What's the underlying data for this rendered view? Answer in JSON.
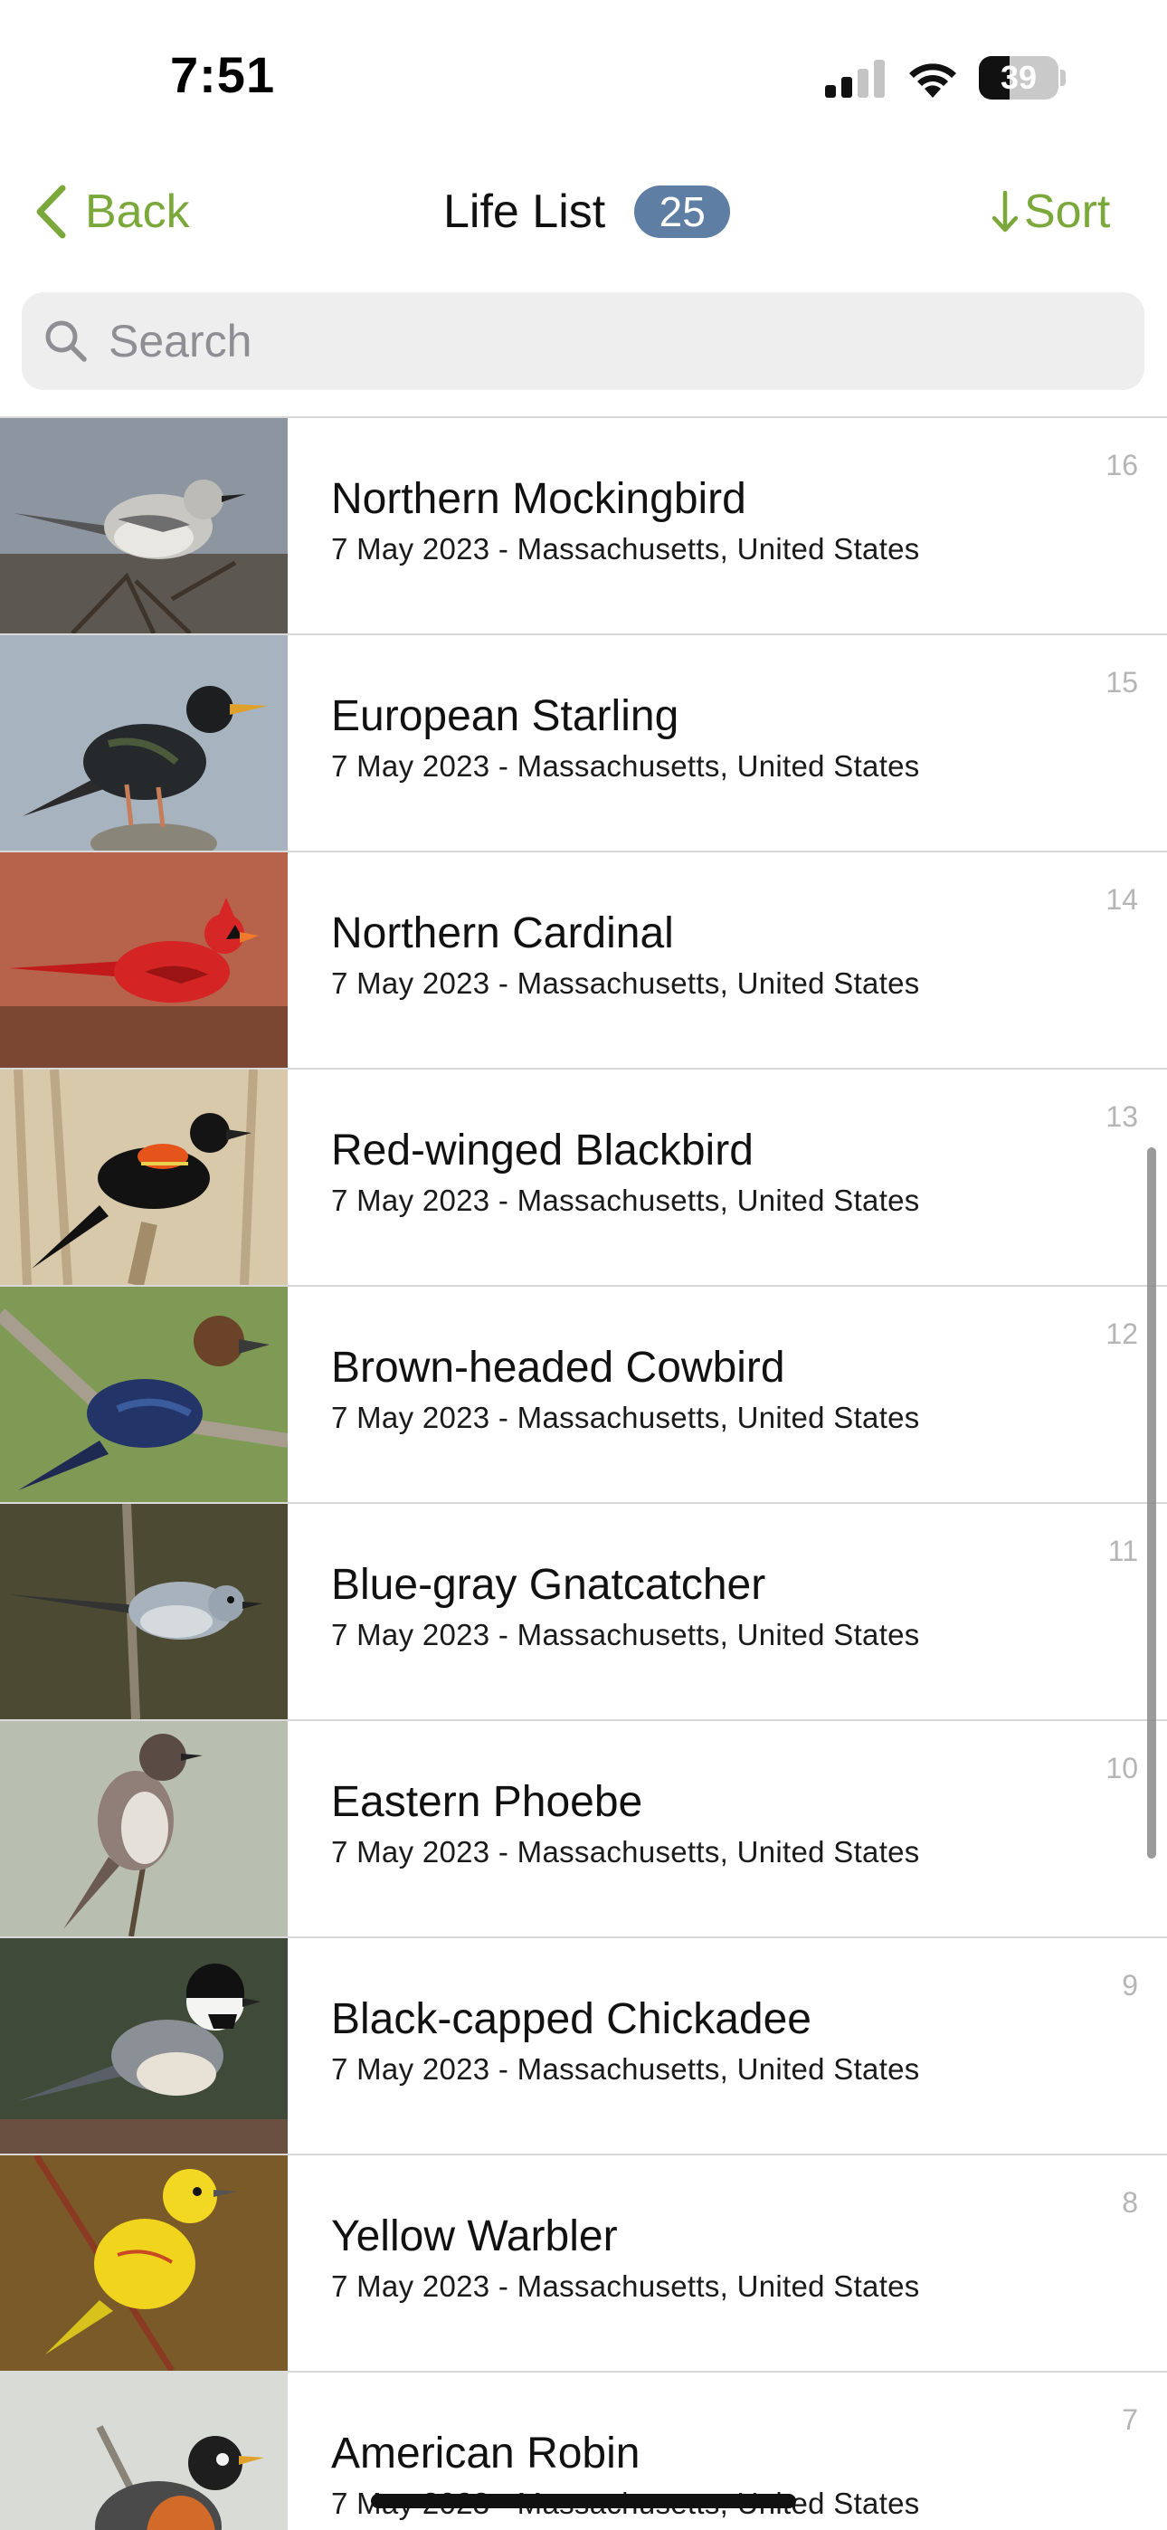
{
  "status_bar": {
    "time": "7:51",
    "battery": "39",
    "battery_level": 0.39
  },
  "nav": {
    "back_label": "Back",
    "title": "Life List",
    "count": "25",
    "sort_label": "Sort"
  },
  "search": {
    "placeholder": "Search",
    "value": ""
  },
  "colors": {
    "accent": "#7aa83a",
    "badge": "#5e7fa3",
    "divider": "#d9d9d9"
  },
  "list": [
    {
      "name": "Northern Mockingbird",
      "sub": "7 May 2023 - Massachusetts, United States",
      "num": "16"
    },
    {
      "name": "European Starling",
      "sub": "7 May 2023 - Massachusetts, United States",
      "num": "15"
    },
    {
      "name": "Northern Cardinal",
      "sub": "7 May 2023 - Massachusetts, United States",
      "num": "14"
    },
    {
      "name": "Red-winged Blackbird",
      "sub": "7 May 2023 - Massachusetts, United States",
      "num": "13"
    },
    {
      "name": "Brown-headed Cowbird",
      "sub": "7 May 2023 - Massachusetts, United States",
      "num": "12"
    },
    {
      "name": "Blue-gray Gnatcatcher",
      "sub": "7 May 2023 - Massachusetts, United States",
      "num": "11"
    },
    {
      "name": "Eastern Phoebe",
      "sub": "7 May 2023 - Massachusetts, United States",
      "num": "10"
    },
    {
      "name": "Black-capped Chickadee",
      "sub": "7 May 2023 - Massachusetts, United States",
      "num": "9"
    },
    {
      "name": "Yellow Warbler",
      "sub": "7 May 2023 - Massachusetts, United States",
      "num": "8"
    },
    {
      "name": "American Robin",
      "sub": "7 May 2023 - Massachusetts, United States",
      "num": "7"
    }
  ]
}
